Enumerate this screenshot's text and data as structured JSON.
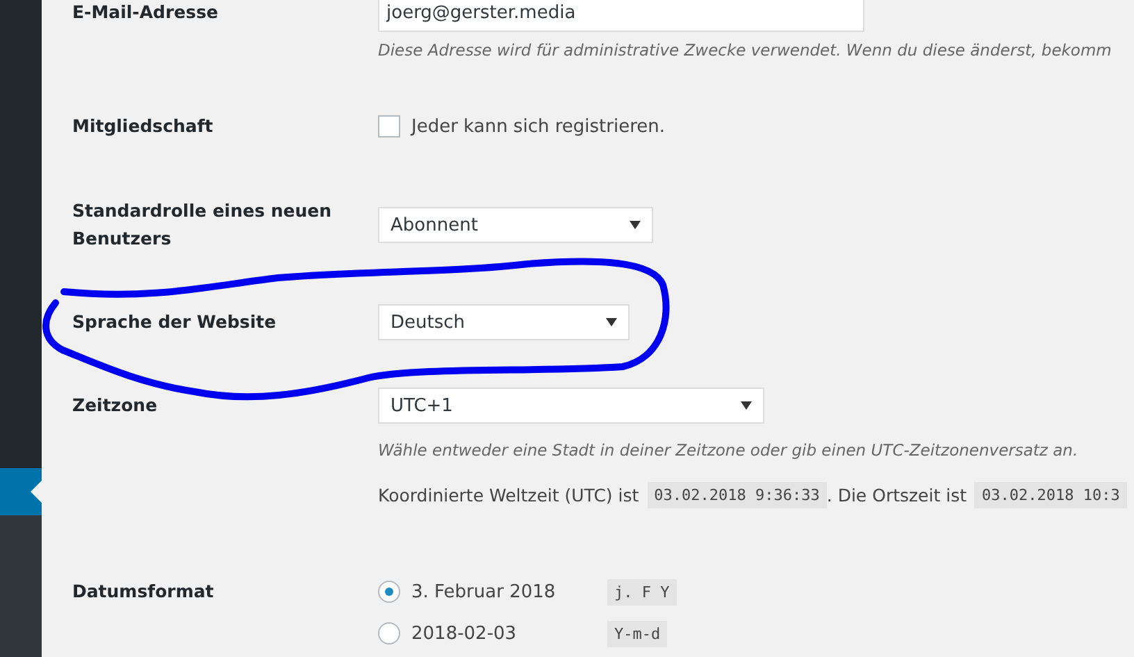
{
  "sidebar": {
    "items": [
      {
        "selected": false
      },
      {
        "selected": true
      },
      {
        "selected": false
      }
    ]
  },
  "settings": [
    {
      "kind": "email",
      "label": "E-Mail-Adresse",
      "value": "joerg@gerster.media",
      "description": "Diese Adresse wird für administrative Zwecke verwendet. Wenn du diese änderst, bekomm"
    },
    {
      "kind": "checkbox",
      "label": "Mitgliedschaft",
      "option": "Jeder kann sich registrieren.",
      "checked": false
    },
    {
      "kind": "select",
      "label": "Standardrolle eines neuen Benutzers",
      "value": "Abonnent"
    },
    {
      "kind": "select",
      "label": "Sprache der Website",
      "value": "Deutsch"
    },
    {
      "kind": "timezone",
      "label": "Zeitzone",
      "value": "UTC+1",
      "description": "Wähle entweder eine Stadt in deiner Zeitzone oder gib einen UTC-Zeitzonenversatz an.",
      "utc_label": "Koordinierte Weltzeit (UTC) ist",
      "utc_time": "03.02.2018 9:36:33",
      "local_label": ". Die Ortszeit ist",
      "local_time": "03.02.2018 10:3"
    },
    {
      "kind": "radio",
      "label": "Datumsformat",
      "options": [
        {
          "text": "3. Februar 2018",
          "code": "j. F Y",
          "selected": true
        },
        {
          "text": "2018-02-03",
          "code": "Y-m-d",
          "selected": false
        }
      ]
    }
  ]
}
